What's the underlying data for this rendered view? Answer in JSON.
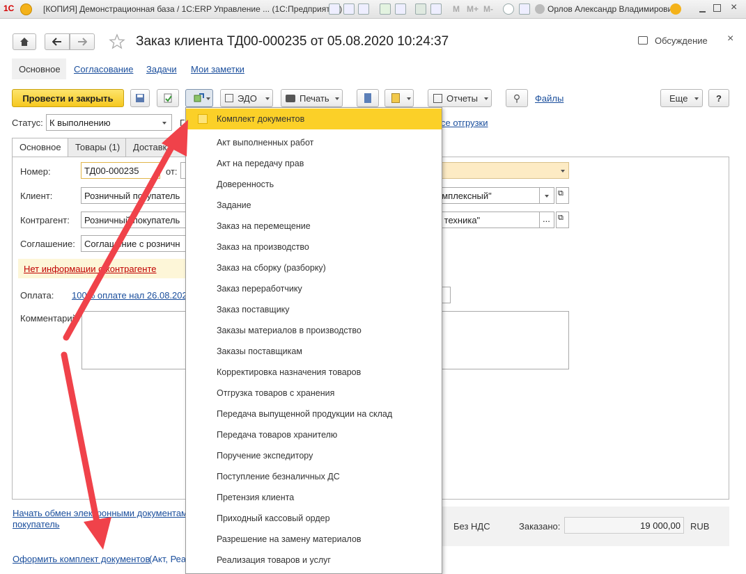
{
  "window": {
    "title": "[КОПИЯ] Демонстрационная база / 1С:ERP Управление ...  (1С:Предприятие)",
    "user": "Орлов Александр Владимирович",
    "m_labels": [
      "M",
      "M+",
      "M-"
    ]
  },
  "header": {
    "doc_title": "Заказ клиента ТД00-000235 от 05.08.2020 10:24:37",
    "discussion": "Обсуждение",
    "close": "×"
  },
  "nav_tabs": [
    "Основное",
    "Согласование",
    "Задачи",
    "Мои заметки"
  ],
  "toolbar": {
    "post_close": "Провести и закрыть",
    "edo": "ЭДО",
    "print": "Печать",
    "reports": "Отчеты",
    "files": "Файлы",
    "more": "Еще",
    "help": "?"
  },
  "status": {
    "label": "Статус:",
    "value": "К выполнению",
    "cut_letter": "Г",
    "right_link": "се отгрузки"
  },
  "form_tabs": [
    "Основное",
    "Товары (1)",
    "Доставка"
  ],
  "fields": {
    "number_label": "Номер:",
    "number_value": "ТД00-000235",
    "from_label": "от:",
    "client_label": "Клиент:",
    "client_value": "Розничный покупатель",
    "counterparty_label": "Контрагент:",
    "counterparty_value": "Розничный покупатель",
    "agreement_label": "Соглашение:",
    "agreement_value": "Соглашение с розничн",
    "warning": "Нет информации о контрагенте",
    "payment_label": "Оплата:",
    "payment_value": "100% оплате нал 26.08.2020",
    "comment_label": "Комментарий:",
    "right_value1": "омплексный\"",
    "right_value2": "я техника\"",
    "ellipsis": "..."
  },
  "bottom": {
    "edo_link": "Начать обмен электронными документами",
    "edo_link2": "покупатель",
    "no_vat": "Без НДС",
    "ordered_label": "Заказано:",
    "ordered_value": "19 000,00",
    "currency": "RUB",
    "docs_link": "Оформить комплект документов",
    "docs_paren": "(Акт, Реа"
  },
  "menu": {
    "items": [
      "Комплект документов",
      "Акт выполненных работ",
      "Акт на передачу прав",
      "Доверенность",
      "Задание",
      "Заказ на перемещение",
      "Заказ на производство",
      "Заказ на сборку (разборку)",
      "Заказ переработчику",
      "Заказ поставщику",
      "Заказы материалов в производство",
      "Заказы поставщикам",
      "Корректировка назначения товаров",
      "Отгрузка товаров с хранения",
      "Передача выпущенной продукции на склад",
      "Передача товаров хранителю",
      "Поручение экспедитору",
      "Поступление безналичных ДС",
      "Претензия клиента",
      "Приходный кассовый ордер",
      "Разрешение на замену материалов",
      "Реализация товаров и услуг"
    ]
  },
  "colors": {
    "accent_yellow": "#fbd028",
    "link_blue": "#1a4e9c",
    "arrow_red": "#f0424a",
    "warning_red": "#c00000"
  }
}
